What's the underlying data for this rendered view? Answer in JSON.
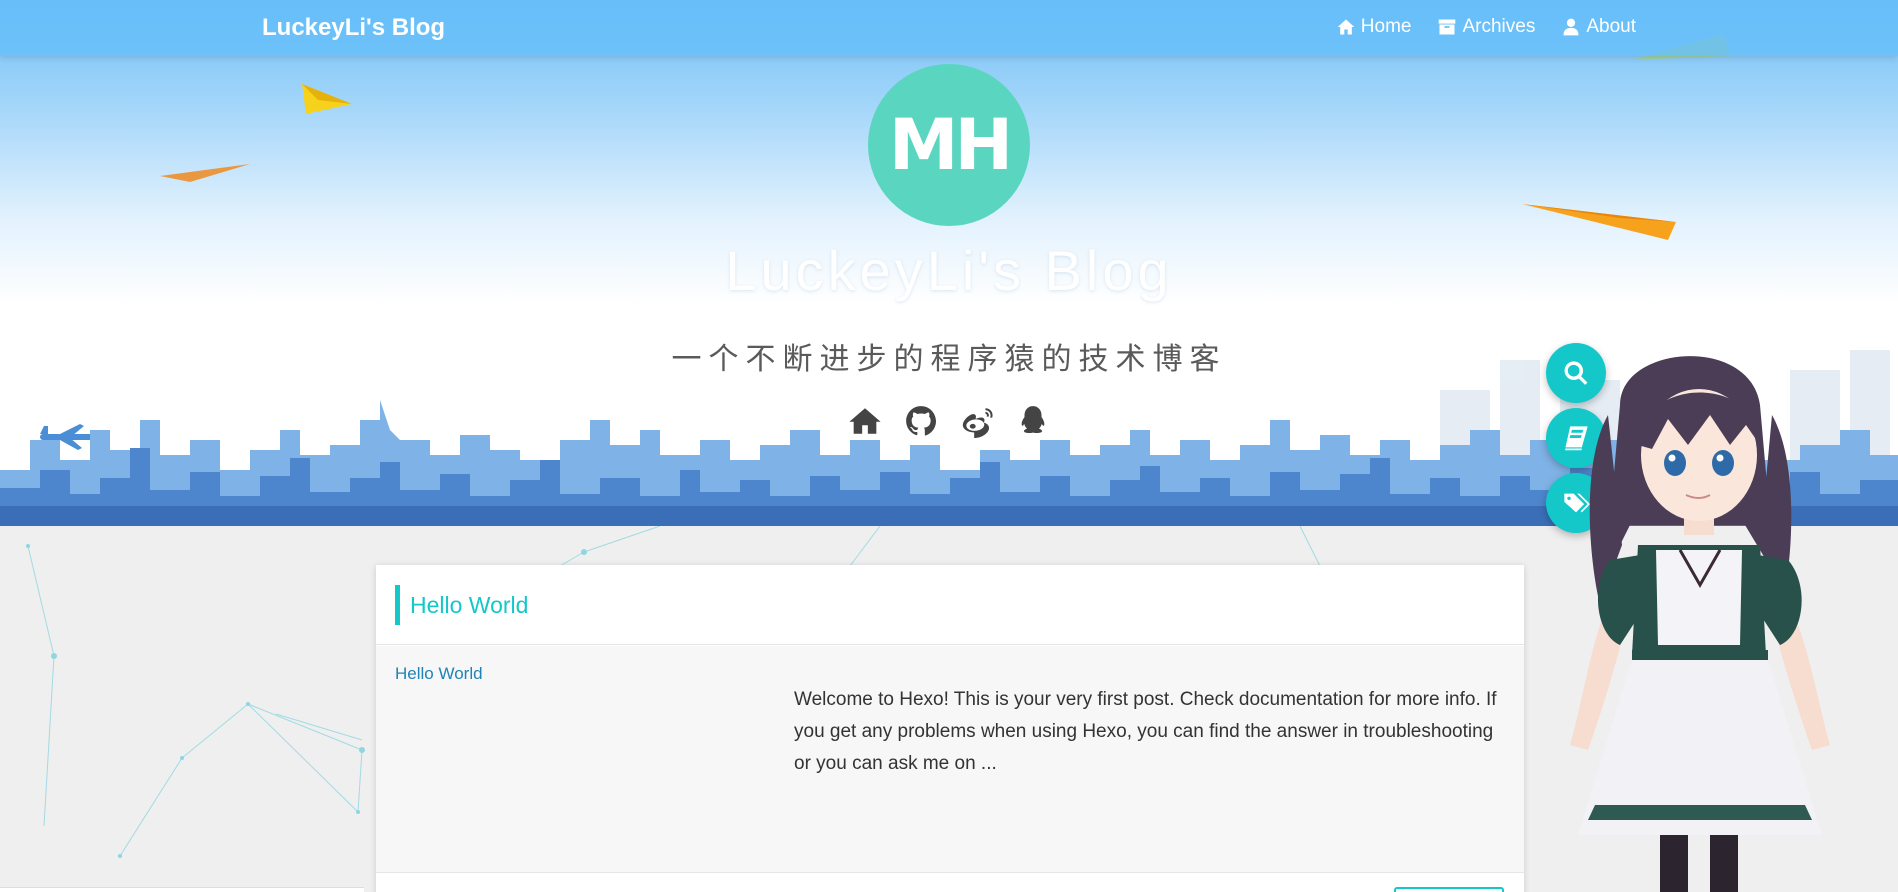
{
  "colors": {
    "accent": "#14c7c9",
    "link": "#1f84b5",
    "nav_bg": "#64befa",
    "logo_bg": "#5ad6c0"
  },
  "navbar": {
    "brand": "LuckeyLi's Blog",
    "items": [
      {
        "label": "Home",
        "icon": "home-icon"
      },
      {
        "label": "Archives",
        "icon": "archive-icon"
      },
      {
        "label": "About",
        "icon": "user-icon"
      }
    ]
  },
  "hero": {
    "logo_text": "MH",
    "title": "LuckeyLi's Blog",
    "subtitle": "一个不断进步的程序猿的技术博客",
    "social": [
      "home-icon",
      "github-icon",
      "weibo-icon",
      "qq-icon"
    ]
  },
  "fabs": [
    "search-icon",
    "book-icon",
    "tags-icon"
  ],
  "posts": [
    {
      "title": "Hello World",
      "link_text": "Hello World",
      "excerpt": "Welcome to Hexo! This is your very first post. Check documentation for more info. If you get any problems when using Hexo, you can find the answer in troubleshooting or you can ask me on ..."
    }
  ]
}
